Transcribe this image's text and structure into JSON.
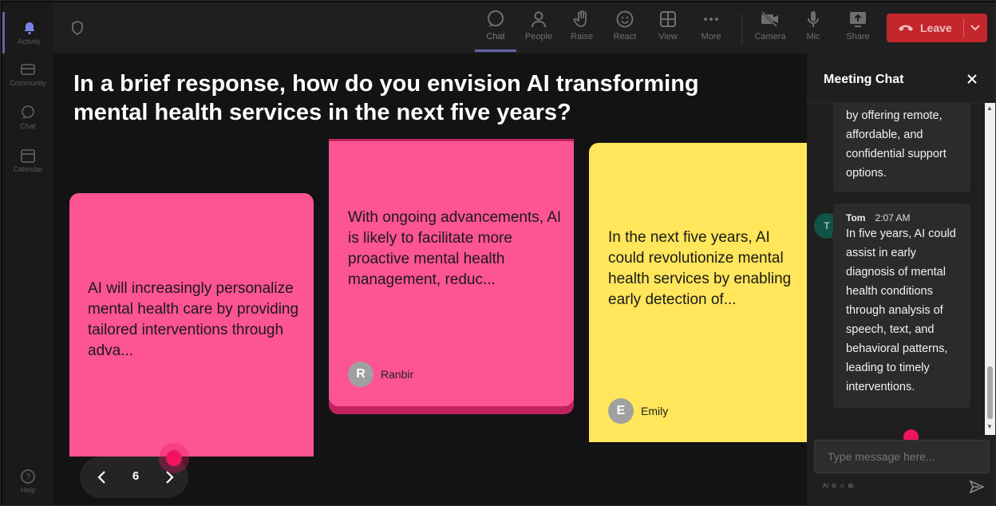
{
  "rail": {
    "items": [
      {
        "label": "Activity",
        "icon": "bell-icon"
      },
      {
        "label": "Community",
        "icon": "community-icon"
      },
      {
        "label": "Chat",
        "icon": "chat-icon"
      },
      {
        "label": "Calendar",
        "icon": "calendar-icon"
      },
      {
        "label": "Help",
        "icon": "help-icon"
      }
    ]
  },
  "toolbar": {
    "buttons": [
      {
        "label": "Chat"
      },
      {
        "label": "People"
      },
      {
        "label": "Raise"
      },
      {
        "label": "React"
      },
      {
        "label": "View"
      },
      {
        "label": "More"
      },
      {
        "label": "Camera"
      },
      {
        "label": "Mic"
      },
      {
        "label": "Share"
      }
    ],
    "leave_label": "Leave"
  },
  "main": {
    "question": "In a brief response, how do you envision AI transforming mental health services in the next five years?",
    "cards": [
      {
        "text": "AI will increasingly personalize mental health care by providing tailored interventions through adva...",
        "author": "",
        "initial": ""
      },
      {
        "text": "With ongoing advancements, AI is likely to facilitate more proactive mental health management, reduc...",
        "author": "Ranbir",
        "initial": "R"
      },
      {
        "text": "In the next five years, AI could revolutionize mental health services by enabling early detection of...",
        "author": "Emily",
        "initial": "E"
      }
    ],
    "pager": {
      "page": "6"
    }
  },
  "chat": {
    "title": "Meeting Chat",
    "messages": [
      {
        "text": "by offering remote, affordable, and confidential support options."
      },
      {
        "author": "Tom",
        "initial": "T",
        "time": "2:07 AM",
        "text": "In five years, AI could assist in early diagnosis of mental health conditions through analysis of speech, text, and behavioral patterns, leading to timely interventions."
      }
    ],
    "input_placeholder": "Type message here..."
  },
  "colors": {
    "accent": "#6264a7",
    "leave": "#c4262e",
    "card_pink": "#fd5493",
    "card_yellow": "#ffe65b",
    "highlight_dot": "#f0145f"
  }
}
